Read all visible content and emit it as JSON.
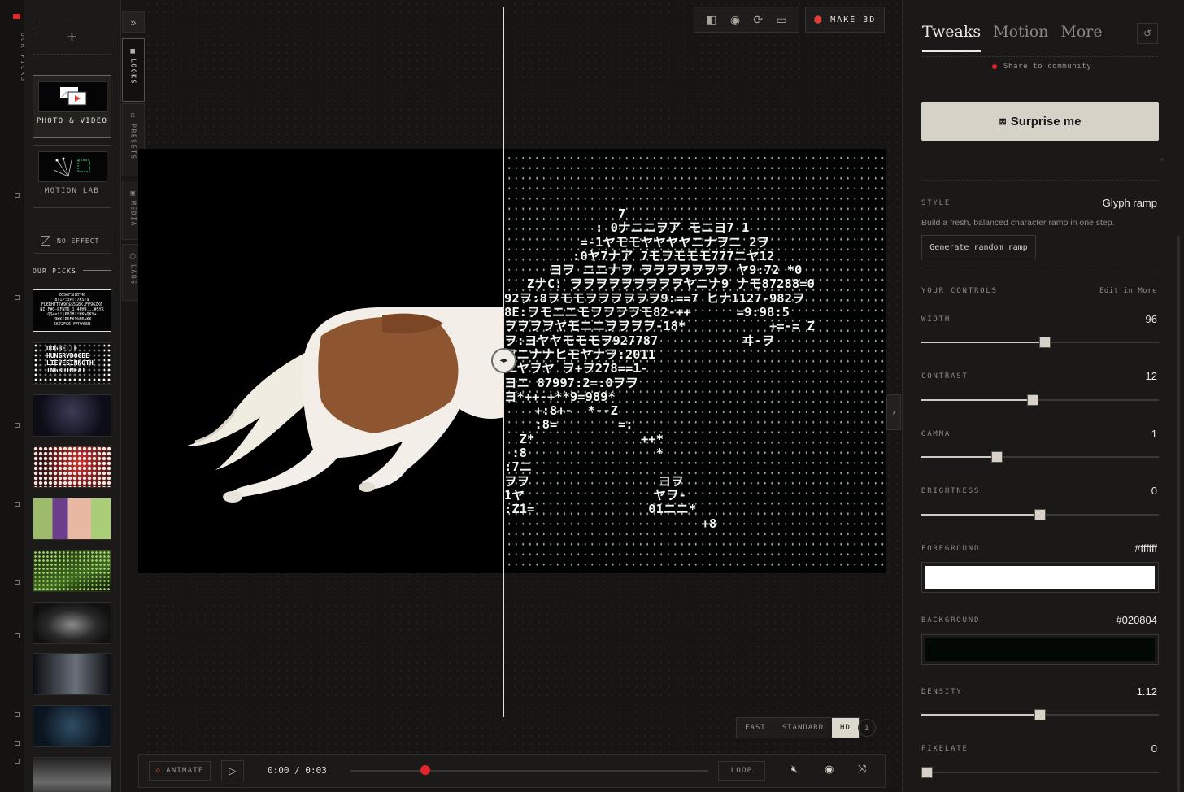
{
  "rail": {
    "vertical_label": "OUR PICKS",
    "accent_color": "#e02a2a"
  },
  "library": {
    "add_symbol": "+",
    "categories": [
      {
        "label": "PHOTO & VIDEO",
        "active": true
      },
      {
        "label": "MOTION LAB",
        "active": false
      }
    ],
    "no_effect_label": "NO EFFECT",
    "picks_header": "OUR PICKS",
    "pick1_lines": [
      "ZOS6FSHZFMG",
      "8TIP:3PT:7KS!9",
      "FLERHTT7#9C$$5G8K,FP96ZK6",
      "NI F#G-RFNT6_1 4PH9...#SYK",
      "QQ+=!!|P018!!KK>QKY+",
      ".9KK!P6EK9%N6+KK",
      "6672FG6.FFPY66H"
    ],
    "pick2_lines": [
      "DOGBELIE",
      "HUNGRYDOGBE",
      "LIEVESINNOTH",
      "INGBUTMEAT"
    ]
  },
  "sidetabs": {
    "expand_icon": "chevrons-right-icon",
    "tabs": [
      {
        "label": "LOOKS",
        "icon": "grid-icon",
        "active": true
      },
      {
        "label": "PRESETS",
        "icon": "bookmark-icon",
        "active": false
      },
      {
        "label": "MEDIA",
        "icon": "image-icon",
        "active": false
      },
      {
        "label": "LABS",
        "icon": "cube-icon",
        "active": false
      }
    ]
  },
  "toolbar": {
    "icons": [
      "split-view-icon",
      "eye-icon",
      "refresh-icon",
      "camera-icon"
    ],
    "make3d_label": "MAKE 3D"
  },
  "preview": {
    "ascii_lines": [
      "               7",
      "            : 0ナ᠎ニニヲア モニヨ7 1",
      "          =-1ヤモモヤヤヤヤニナヲニ 2ヲ",
      "         :0ヤ7ナア 7モヲモモモ777ニヤ12",
      "      ヨヲ ニニナヲ ヲヲヲヲヲヲヲ ヤ9:72 *0",
      "   ZナC: ヲヲヲヲヲヲヲヲヲヤニナ9 ナモ87288=0",
      "92ヲ:8ヲモモヲヲヲヲヲヲ9:==7 ヒナ1127-982ヲ",
      "8E:ヲモニニモヲヲヲヲモ82-++      =9:98:5",
      "ヲヲヲヲヤモニニヲヲヲヲ-18*           +=-= Z",
      "ヲ:ヨヤヤモモモヲ927787           ヰ-ヲ",
      "ヲニナナヒモヤナヲ:2011",
      "ニヤヲヤ ヲ+ヲ278==1-",
      "ヨニ 87997:2=:0ヲヲ",
      "ヨ*++-+**9=989*",
      "    +:8+-  *--Z",
      "    :8=        =:",
      "  Z*              ++*",
      " :8                 *",
      ":7ニ",
      "ヲヲ                 ヨヲ",
      "1ヤ                 ヤヲ-",
      ":Z1=               01ニニ*",
      "                          +8"
    ]
  },
  "quality": {
    "options": [
      "FAST",
      "STANDARD",
      "HD"
    ],
    "selected": "HD",
    "info_symbol": "i"
  },
  "playbar": {
    "animate_label": "ANIMATE",
    "time_current": "0:00",
    "time_total": "0:03",
    "time_display": "0:00 / 0:03",
    "progress": 0.21,
    "loop_label": "LOOP",
    "icons": [
      "play-icon",
      "mute-icon",
      "eye-icon",
      "shuffle-icon"
    ]
  },
  "panel": {
    "tabs": [
      "Tweaks",
      "Motion",
      "More"
    ],
    "active_tab": "Tweaks",
    "share_label": "Share to community",
    "surprise_label": "Surprise me",
    "style_caption": "STYLE",
    "style_value": "Glyph ramp",
    "style_description": "Build a fresh, balanced character ramp in one step.",
    "generate_label": "Generate random ramp",
    "controls_caption": "YOUR CONTROLS",
    "edit_more_label": "Edit in More",
    "sliders": [
      {
        "label": "WIDTH",
        "value": "96",
        "position": 0.52
      },
      {
        "label": "CONTRAST",
        "value": "12",
        "position": 0.47
      },
      {
        "label": "GAMMA",
        "value": "1",
        "position": 0.32
      },
      {
        "label": "BRIGHTNESS",
        "value": "0",
        "position": 0.5
      }
    ],
    "foreground_label": "FOREGROUND",
    "foreground_value": "#ffffff",
    "background_label": "BACKGROUND",
    "background_value": "#020804",
    "density": {
      "label": "DENSITY",
      "value": "1.12",
      "position": 0.5
    },
    "pixelate": {
      "label": "PIXELATE",
      "value": "0",
      "position": 0.0
    }
  }
}
